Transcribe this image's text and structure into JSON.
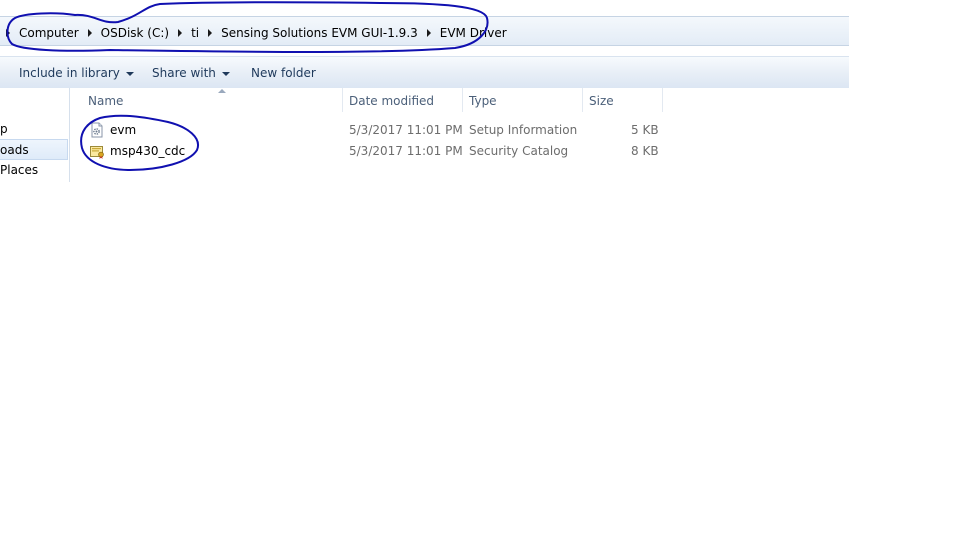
{
  "breadcrumb": [
    "Computer",
    "OSDisk (C:)",
    "ti",
    "Sensing Solutions EVM GUI-1.9.3",
    "EVM Driver"
  ],
  "toolbar": {
    "include_in_library": "Include in library",
    "share_with": "Share with",
    "new_folder": "New folder"
  },
  "nav": {
    "items": [
      {
        "label": "p"
      },
      {
        "label": "oads"
      },
      {
        "label": " Places"
      }
    ]
  },
  "columns": {
    "name": "Name",
    "date_modified": "Date modified",
    "type": "Type",
    "size": "Size"
  },
  "files": [
    {
      "name": "evm",
      "date": "5/3/2017 11:01 PM",
      "type": "Setup Information",
      "size": "5 KB",
      "icon": "setup-information-file-icon"
    },
    {
      "name": "msp430_cdc",
      "date": "5/3/2017 11:01 PM",
      "type": "Security Catalog",
      "size": "8 KB",
      "icon": "security-catalog-file-icon"
    }
  ],
  "colors": {
    "annotation": "#1010b0",
    "selection_bg": "#dfebf9",
    "toolbar_text": "#1e395b"
  }
}
